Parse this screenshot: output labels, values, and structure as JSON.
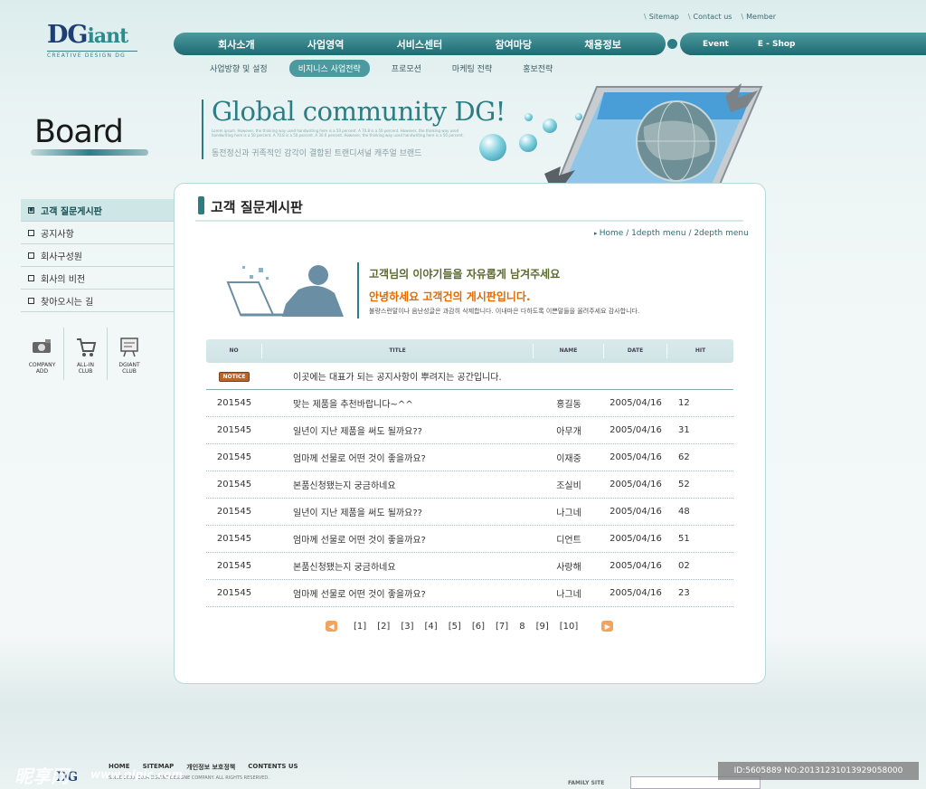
{
  "logo": {
    "main": "DG",
    "accent": "iant",
    "sub": "CREATIVE DESIGN DG"
  },
  "util_links": [
    "Sitemap",
    "Contact us",
    "Member"
  ],
  "main_nav": [
    "회사소개",
    "사업영역",
    "서비스센터",
    "참여마당",
    "채용정보"
  ],
  "right_nav": [
    "Event",
    "E - Shop"
  ],
  "sub_nav": [
    {
      "label": "사업방향 및 설정",
      "active": false
    },
    {
      "label": "비지니스 사업전략",
      "active": true
    },
    {
      "label": "프로모션",
      "active": false
    },
    {
      "label": "마케팅 전략",
      "active": false
    },
    {
      "label": "홍보전략",
      "active": false
    }
  ],
  "board_title": "Board",
  "hero": {
    "title": "Global community DG!",
    "fine_print": "Lorem ipsum. However, the thinking way used handwriting here is a 50 percent. A 70.8 is a 50 percent. However, the thinking way used handwriting here is a 50 percent. A 70.8 is a 50 percent. A 30.0 percent. However, the thinking way used handwriting here is a 50 percent.",
    "tagline": "동전정신과 귀족적인 감각이 결합된 트랜디셔널 캐주얼 브랜드"
  },
  "sidebar": {
    "items": [
      {
        "label": "고객 질문게시판",
        "active": true
      },
      {
        "label": "공지사항",
        "active": false
      },
      {
        "label": "회사구성원",
        "active": false
      },
      {
        "label": "회사의 비전",
        "active": false
      },
      {
        "label": "찾아오시는 길",
        "active": false
      }
    ],
    "quick": [
      {
        "label": "COMPANY\nADD",
        "icon": "camera-icon"
      },
      {
        "label": "ALL-IN\nCLUB",
        "icon": "cart-icon"
      },
      {
        "label": "DGIANT\nCLUB",
        "icon": "notice-board-icon"
      }
    ]
  },
  "content": {
    "title": "고객 질문게시판",
    "breadcrumb": "Home / 1depth menu / 2depth menu",
    "intro_line1": "고객님의 이야기들을 자유롭게 남겨주세요",
    "intro_line2": "안녕하세요 고객건의 게시판입니다.",
    "intro_line3": "불량스런말이나 음난성글은 과감히 삭제합니다. 이내마은 다하도록 이쁜말들을 올려주세요 감사합니다."
  },
  "table": {
    "headers": [
      "NO",
      "TITLE",
      "NAME",
      "DATE",
      "HIT"
    ],
    "notice": {
      "badge": "NOTICE",
      "title": "이곳에는 대표가 되는 공지사항이 뿌려지는 공간입니다."
    },
    "rows": [
      {
        "no": "201545",
        "title": "맞는 제품을 추천바랍니다~^^",
        "name": "홍길동",
        "date": "2005/04/16",
        "hit": "12"
      },
      {
        "no": "201545",
        "title": "일년이 지난 제품을 써도 될까요??",
        "name": "아무개",
        "date": "2005/04/16",
        "hit": "31"
      },
      {
        "no": "201545",
        "title": "엄마께 선물로 어떤 것이 좋을까요?",
        "name": "이재중",
        "date": "2005/04/16",
        "hit": "62"
      },
      {
        "no": "201545",
        "title": "본품신청됐는지 궁금하네요",
        "name": "조실비",
        "date": "2005/04/16",
        "hit": "52"
      },
      {
        "no": "201545",
        "title": "일년이 지난 제품을 써도 될까요??",
        "name": "나그네",
        "date": "2005/04/16",
        "hit": "48"
      },
      {
        "no": "201545",
        "title": "엄마께 선물로 어떤 것이 좋을까요?",
        "name": "디언트",
        "date": "2005/04/16",
        "hit": "51"
      },
      {
        "no": "201545",
        "title": "본품신청됐는지 궁금하네요",
        "name": "사랑해",
        "date": "2005/04/16",
        "hit": "02"
      },
      {
        "no": "201545",
        "title": "엄마께 선물로 어떤 것이 좋을까요?",
        "name": "나그네",
        "date": "2005/04/16",
        "hit": "23"
      }
    ]
  },
  "pagination": {
    "pages": [
      "[1]",
      "[2]",
      "[3]",
      "[4]",
      "[5]",
      "[6]",
      "[7]",
      "8",
      "[9]",
      "[10]"
    ],
    "current": "8"
  },
  "footer": {
    "logo": "DG",
    "links": [
      "HOME",
      "SITEMAP",
      "개인정보 보호정책",
      "CONTENTS US"
    ],
    "copyright": "SINCE 2000, 2004 DGIANT DESIGNE COMPANY. ALL RIGHTS RESERVED.",
    "family_site_label": "FAMILY SITE"
  },
  "watermark": {
    "left_text": "昵享网",
    "url": "www.nipic.com",
    "right_text": "ID:5605889 NO:20131231013929058000"
  },
  "colors": {
    "primary": "#2b7c83",
    "accent_orange": "#e36a00",
    "notice_badge": "#b9642c"
  }
}
